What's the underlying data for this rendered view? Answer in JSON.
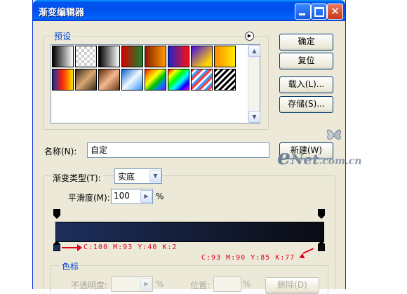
{
  "window": {
    "title": "渐变编辑器"
  },
  "buttons": {
    "ok": "确定",
    "reset": "复位",
    "load": "载入(L)...",
    "save": "存储(S)...",
    "new": "新建(W)"
  },
  "presets": {
    "legend": "预设",
    "menu_icon": "circle-arrow-icon",
    "swatches": [
      "linear-gradient(90deg,#000,#fff)",
      "checker",
      "linear-gradient(90deg,#000,#fff)",
      "linear-gradient(90deg,#d40000,#108a2a)",
      "linear-gradient(90deg,#8a1a00,#ff9a00)",
      "linear-gradient(90deg,#1a23d0,#ff1010)",
      "linear-gradient(135deg,#5a1fd0 10%,#ffd400 80%)",
      "linear-gradient(90deg,#ff8a00,#ffee00)",
      "linear-gradient(90deg,#1d2aa0,#ff2a00,#ffe400)",
      "linear-gradient(135deg,#3a2a18,#d8a870,#3a2a18)",
      "linear-gradient(135deg,#5a2a00,#f4b890,#6a3a10)",
      "linear-gradient(135deg,#1060d0,#f0f8ff,#3090ff)",
      "linear-gradient(135deg,#ff0000,#ff9900,#ffff00,#00c000,#0080ff,#9000ff)",
      "linear-gradient(135deg,#ff0000,#ffff00,#00ff00,#00ffff,#0000ff,#ff00ff)",
      "repeating-linear-gradient(135deg,#ff3a3a 0 3px,#fff 3px 6px,#3a9aff 6px 9px)",
      "repeating-linear-gradient(135deg,#000 0 3px,#fff 3px 6px)"
    ]
  },
  "name": {
    "label": "名称(N):",
    "value": "自定"
  },
  "gradient_settings": {
    "type_label": "渐变类型(T):",
    "type_value": "实底",
    "smoothness_label": "平滑度(M):",
    "smoothness_value": "100",
    "percent": "%"
  },
  "bar": {
    "left_color": "#1d2f5d",
    "right_color": "#0a0c13"
  },
  "annotations": {
    "left": "C:100 M:93 Y:40 K:2",
    "right": "C:93 M:90 Y:85 K:77",
    "color": "#e0001a"
  },
  "stops": {
    "legend": "色标",
    "opacity_label": "不透明度:",
    "percent": "%",
    "location_label": "位置:",
    "delete": "删除(D)"
  },
  "watermark": {
    "e": "e",
    "net": "Net",
    "suffix": ".com.cn"
  }
}
